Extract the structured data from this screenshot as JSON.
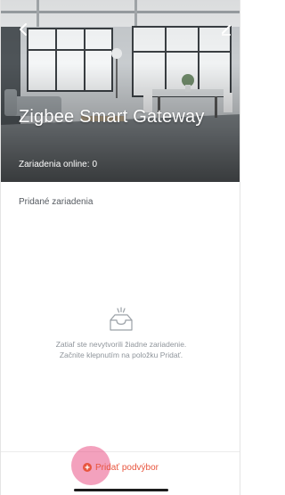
{
  "header": {
    "back_icon": "chevron-left-icon",
    "edit_icon": "pencil-icon",
    "title": "Zigbee Smart Gateway",
    "online_label": "Zariadenia online:",
    "online_count": "0"
  },
  "devices": {
    "section_title": "Pridané zariadenia",
    "empty_icon": "empty-inbox-icon",
    "empty_line1": "Zatiaľ ste nevytvorili žiadne zariadenie.",
    "empty_line2": "Začnite klepnutím na položku Pridať."
  },
  "footer": {
    "add_icon": "plus-circle-icon",
    "add_label": "Pridať podvýbor"
  },
  "colors": {
    "accent": "#e8553e",
    "press_highlight": "#e95486",
    "muted_text": "#8f959b"
  }
}
